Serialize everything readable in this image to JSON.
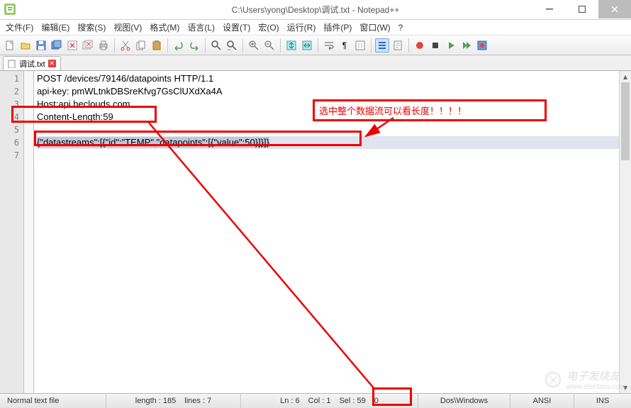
{
  "window": {
    "title": "C:\\Users\\yong\\Desktop\\调试.txt - Notepad++"
  },
  "menu": {
    "items": [
      "文件(F)",
      "编辑(E)",
      "搜索(S)",
      "视图(V)",
      "格式(M)",
      "语言(L)",
      "设置(T)",
      "宏(O)",
      "运行(R)",
      "插件(P)",
      "窗口(W)",
      "?"
    ]
  },
  "tab": {
    "label": "调试.txt"
  },
  "code": {
    "l1": "POST /devices/79146/datapoints HTTP/1.1",
    "l2": "api-key: pmWLtnkDBSreKfvg7GsClUXdXa4A",
    "l3": "Host:api.heclouds.com",
    "l4": "Content-Length:59",
    "l5": "",
    "l6": "{\"datastreams\":[{\"id\":\"TEMP\",\"datapoints\":[{\"value\":50}]}]}",
    "l7": ""
  },
  "gutter": {
    "n1": "1",
    "n2": "2",
    "n3": "3",
    "n4": "4",
    "n5": "5",
    "n6": "6",
    "n7": "7"
  },
  "callout": {
    "text": "选中整个数据流可以看长度！！！！"
  },
  "status": {
    "filetype": "Normal text file",
    "length": "length : 185",
    "lines": "lines : 7",
    "ln": "Ln : 6",
    "col": "Col : 1",
    "sel": "Sel : 59",
    "selextra": "0",
    "eol": "Dos\\Windows",
    "enc": "ANSI",
    "ins": "INS"
  },
  "watermark": {
    "text": "电子发烧友",
    "url": "www.elecfans.com"
  }
}
